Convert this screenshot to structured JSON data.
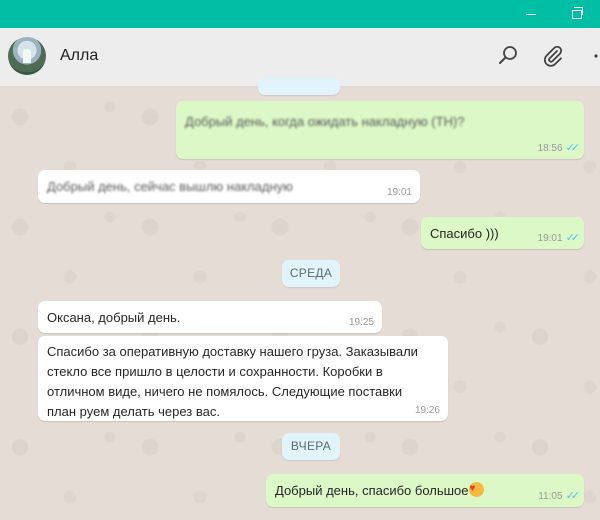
{
  "contact": {
    "name": "Алла"
  },
  "date_chips": {
    "wednesday": "СРЕДА",
    "yesterday": "ВЧЕРА"
  },
  "messages": [
    {
      "direction": "out",
      "text": "Добрый день, когда ожидать накладную (ТН)?",
      "time": "18:56",
      "blurred": true
    },
    {
      "direction": "in",
      "text": "Добрый день, сейчас вышлю накладную",
      "time": "19:01",
      "blurred": true
    },
    {
      "direction": "out",
      "text": "Спасибо )))",
      "time": "19:01"
    },
    {
      "direction": "in",
      "text": "Оксана, добрый день.",
      "time": "19:25"
    },
    {
      "direction": "in",
      "text": "Спасибо за оперативную доставку нашего груза. Заказывали\nстекло все пришло в целости и сохранности. Коробки в\nотличном виде, ничего не помялось. Следующие поставки\nплан руем делать через вас.",
      "time": "19:26"
    },
    {
      "direction": "out",
      "text": "Добрый день, спасибо большое",
      "time": "11:05"
    }
  ],
  "icons": {
    "search": "search-icon",
    "attach": "paperclip-icon",
    "menu": "more-vertical-icon",
    "read": "double-check-icon",
    "emoji": "heart-face-emoji-icon"
  },
  "colors": {
    "titlebar": "#00bfa5",
    "outgoing": "#dcf8c6",
    "incoming": "#ffffff",
    "chip": "#e1f3fb",
    "read_ticks": "#4fc3f7"
  }
}
